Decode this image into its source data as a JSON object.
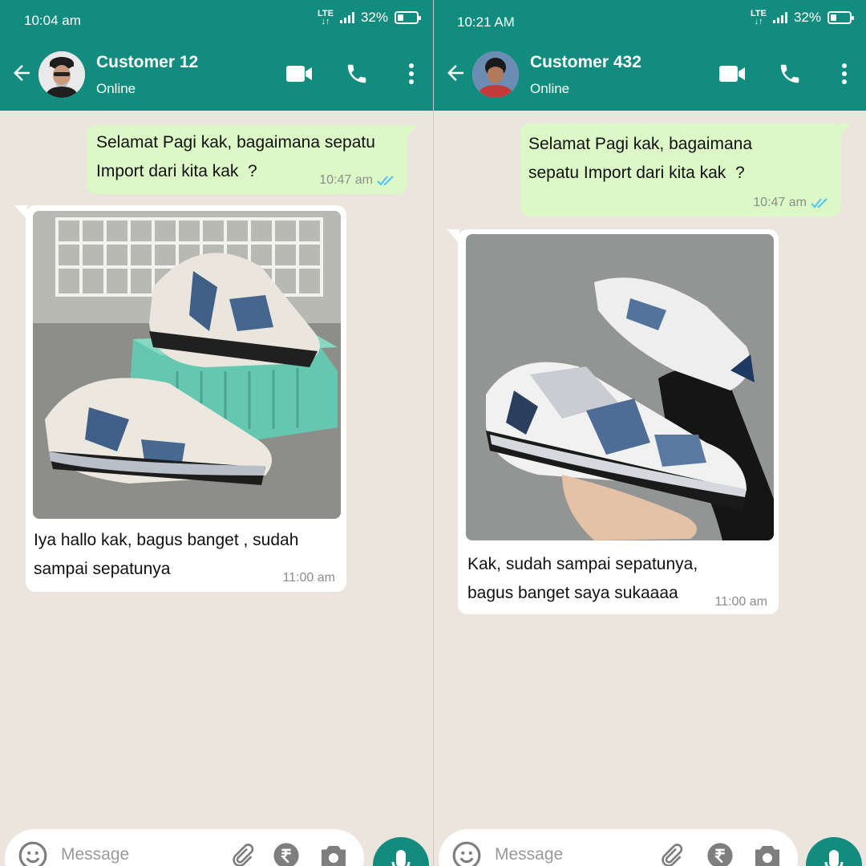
{
  "panels": [
    {
      "status_time": "10:04 am",
      "network": "LTE",
      "battery": "32%",
      "battery_level": 0.32,
      "contact_name": "Customer 12",
      "contact_status": "Online",
      "outgoing_text": "Selamat Pagi kak, bagaimana sepatu\nImport dari kita kak  ?",
      "outgoing_time": "10:47 am",
      "incoming_text": "Iya hallo kak, bagus banget , sudah\nsampai sepatunya",
      "incoming_time": "11:00 am",
      "input_placeholder": "Message"
    },
    {
      "status_time": "10:21 AM",
      "network": "LTE",
      "battery": "32%",
      "battery_level": 0.32,
      "contact_name": "Customer 432",
      "contact_status": "Online",
      "outgoing_text": "Selamat Pagi kak, bagaimana\nsepatu Import dari kita kak  ?",
      "outgoing_time": "10:47 am",
      "incoming_text": "Kak, sudah sampai sepatunya,\nbagus banget saya sukaaaa",
      "incoming_time": "11:00 am",
      "input_placeholder": "Message"
    }
  ],
  "colors": {
    "header": "#128c7e",
    "chat_background": "#ece5dd",
    "outgoing_bubble": "#dcf8c6",
    "incoming_bubble": "#ffffff",
    "read_ticks": "#4fc3f7"
  },
  "icons": [
    "back-arrow-icon",
    "video-call-icon",
    "phone-icon",
    "more-vert-icon",
    "emoji-icon",
    "attach-icon",
    "rupee-icon",
    "camera-icon",
    "mic-icon",
    "double-check-icon"
  ]
}
